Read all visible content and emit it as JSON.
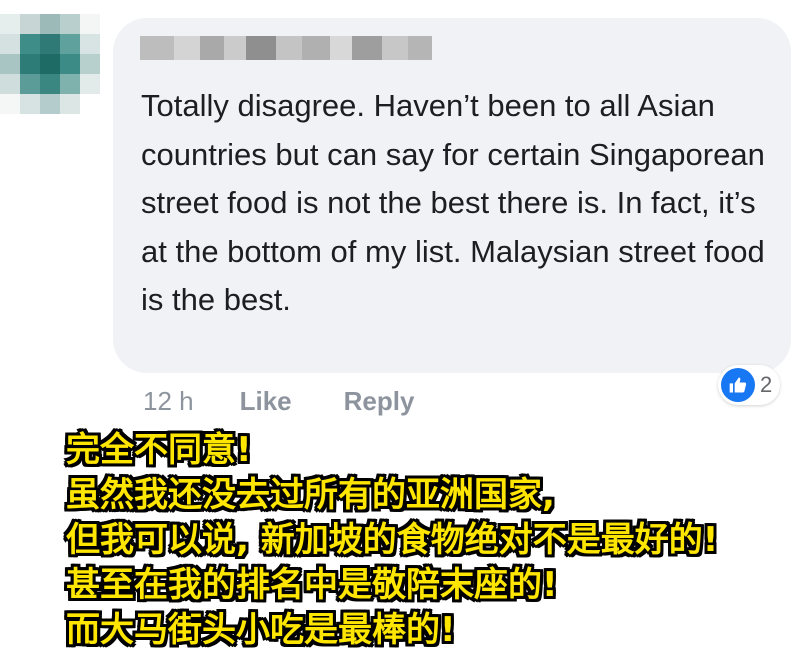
{
  "comment": {
    "author_redacted": true,
    "text": "Totally disagree. Haven’t been to all Asian countries but can say for certain Singaporean street food is not the best there is. In fact, it’s at the bottom of my list. Malaysian street food is the best.",
    "timestamp": "12 h",
    "like_label": "Like",
    "reply_label": "Reply",
    "reaction_count": "2",
    "reaction_icon": "thumbs-up-icon",
    "bubble_color": "#f0f2f5",
    "reaction_color": "#1877f2"
  },
  "translation": {
    "lines": [
      "完全不同意!",
      "虽然我还没去过所有的亚洲国家,",
      "但我可以说, 新加坡的食物绝对不是最好的!",
      "甚至在我的排名中是敬陪末座的!",
      "而大马街头小吃是最棒的!"
    ],
    "text_color": "#ffe600",
    "outline_color": "#000000"
  }
}
